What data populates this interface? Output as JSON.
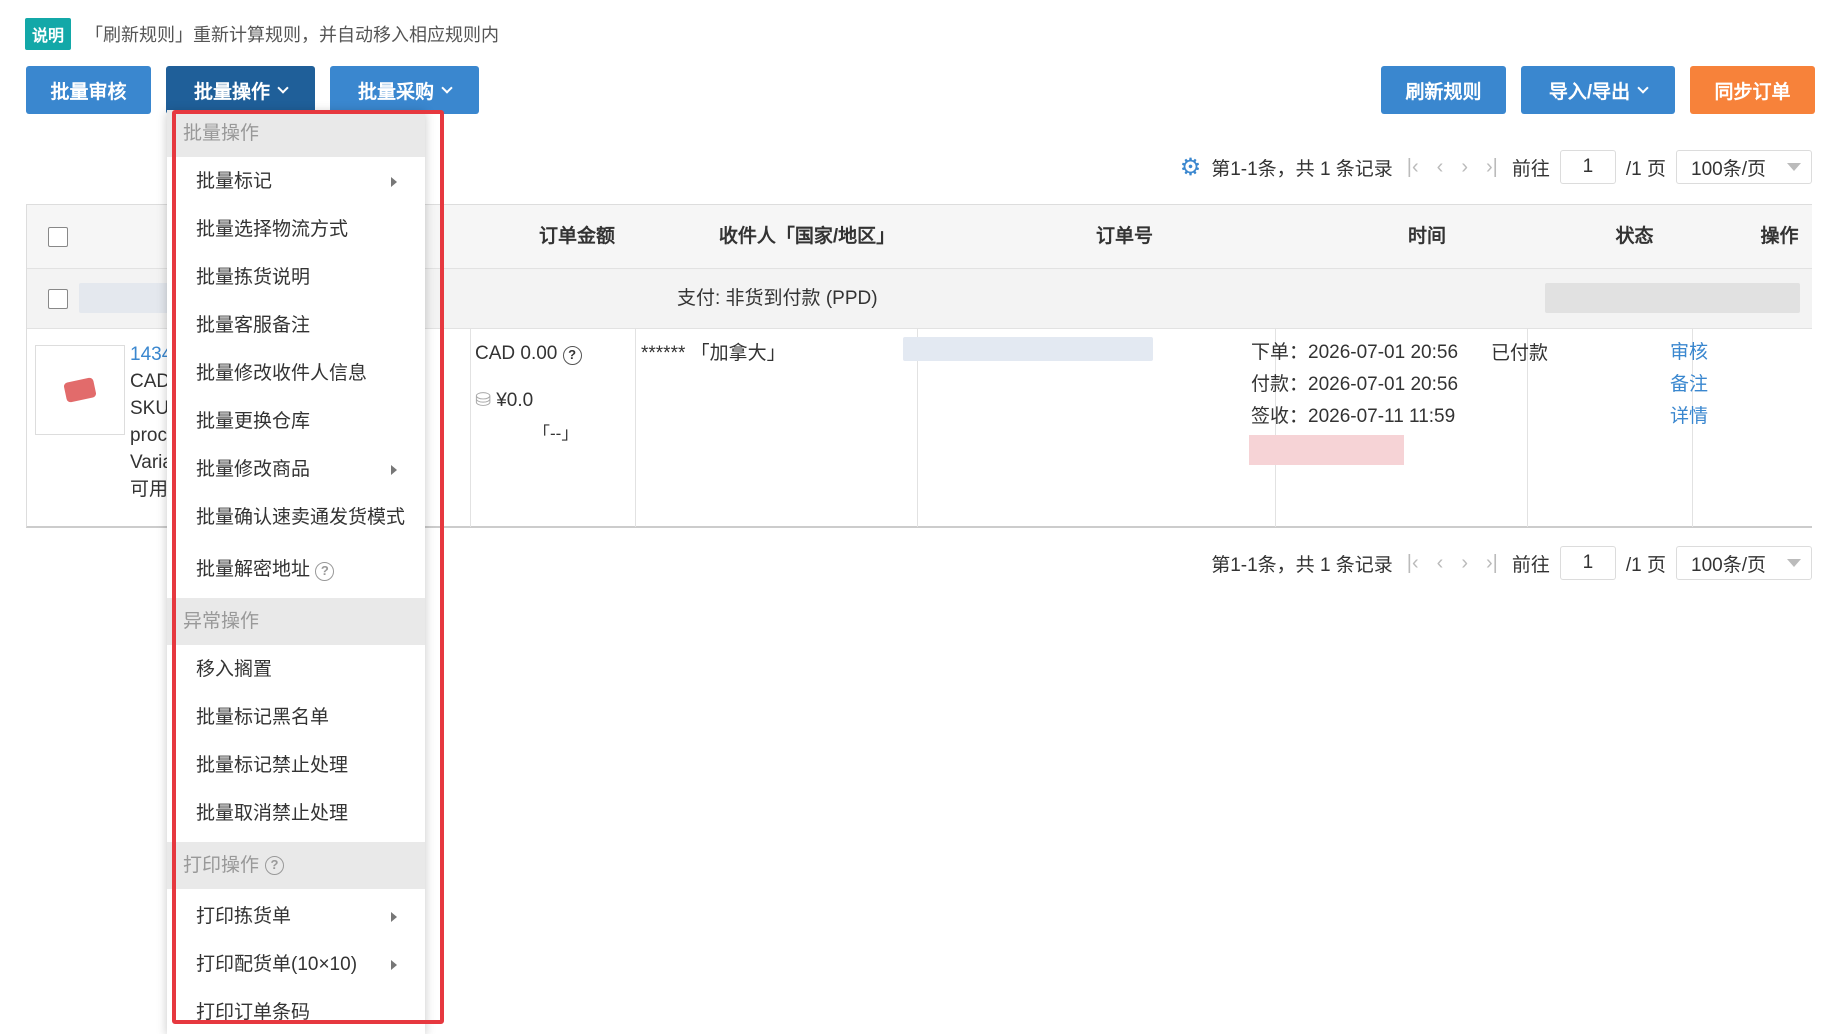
{
  "notice": {
    "badge": "说明",
    "text": "「刷新规则」重新计算规则，并自动移入相应规则内"
  },
  "toolbar": {
    "batch_review": "批量审核",
    "batch_ops": "批量操作",
    "batch_purchase": "批量采购",
    "refresh_rules": "刷新规则",
    "import_export": "导入/导出",
    "sync_orders": "同步订单"
  },
  "pager": {
    "summary": "第1-1条，共 1 条记录",
    "goto": "前往",
    "page_value": "1",
    "total_pages": "/1 页",
    "page_size": "100条/页"
  },
  "table": {
    "headers": {
      "amount": "订单金额",
      "recipient": "收件人「国家/地区」",
      "order_no": "订单号",
      "time": "时间",
      "status": "状态",
      "actions": "操作"
    },
    "group_payment": "支付: 非货到付款 (PPD)",
    "row": {
      "product_lines": [
        "1434",
        "CAD",
        "SKU",
        "proc",
        "Varia",
        "可用"
      ],
      "amount": "CAD 0.00",
      "cost": "¥0.0",
      "cost_note": "「--」",
      "recipient": "****** 「加拿大」",
      "time_order": "下单：2026-07-01 20:56",
      "time_paid": "付款：2026-07-01 20:56",
      "time_signed": "签收：2026-07-11 11:59",
      "status": "已付款",
      "action_review": "审核",
      "action_note": "备注",
      "action_detail": "详情"
    }
  },
  "menu": {
    "section_batch": "批量操作",
    "batch_items": [
      "批量标记",
      "批量选择物流方式",
      "批量拣货说明",
      "批量客服备注",
      "批量修改收件人信息",
      "批量更换仓库",
      "批量修改商品",
      "批量确认速卖通发货模式",
      "批量解密地址"
    ],
    "section_exception": "异常操作",
    "exception_items": [
      "移入搁置",
      "批量标记黑名单",
      "批量标记禁止处理",
      "批量取消禁止处理"
    ],
    "section_print": "打印操作",
    "print_items": [
      "打印拣货单",
      "打印配货单(10×10)",
      "打印订单条码"
    ]
  }
}
